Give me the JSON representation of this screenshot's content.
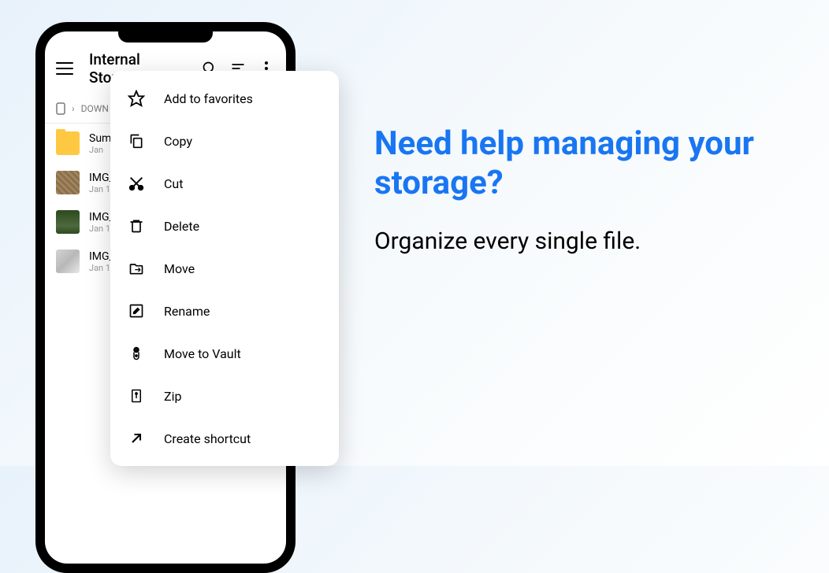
{
  "app": {
    "title": "Internal Storage"
  },
  "breadcrumb": {
    "path": "DOWN"
  },
  "files": [
    {
      "name": "Sum",
      "date": "Jan"
    },
    {
      "name": "IMG_",
      "date": "Jan 1"
    },
    {
      "name": "IMG_",
      "date": "Jan 1"
    },
    {
      "name": "IMG_",
      "date": "Jan 1"
    }
  ],
  "menu": {
    "items": [
      {
        "label": "Add to favorites"
      },
      {
        "label": "Copy"
      },
      {
        "label": "Cut"
      },
      {
        "label": "Delete"
      },
      {
        "label": "Move"
      },
      {
        "label": "Rename"
      },
      {
        "label": "Move to Vault"
      },
      {
        "label": "Zip"
      },
      {
        "label": "Create shortcut"
      }
    ]
  },
  "marketing": {
    "headline": "Need help managing your storage?",
    "subline": "Organize every single file."
  }
}
